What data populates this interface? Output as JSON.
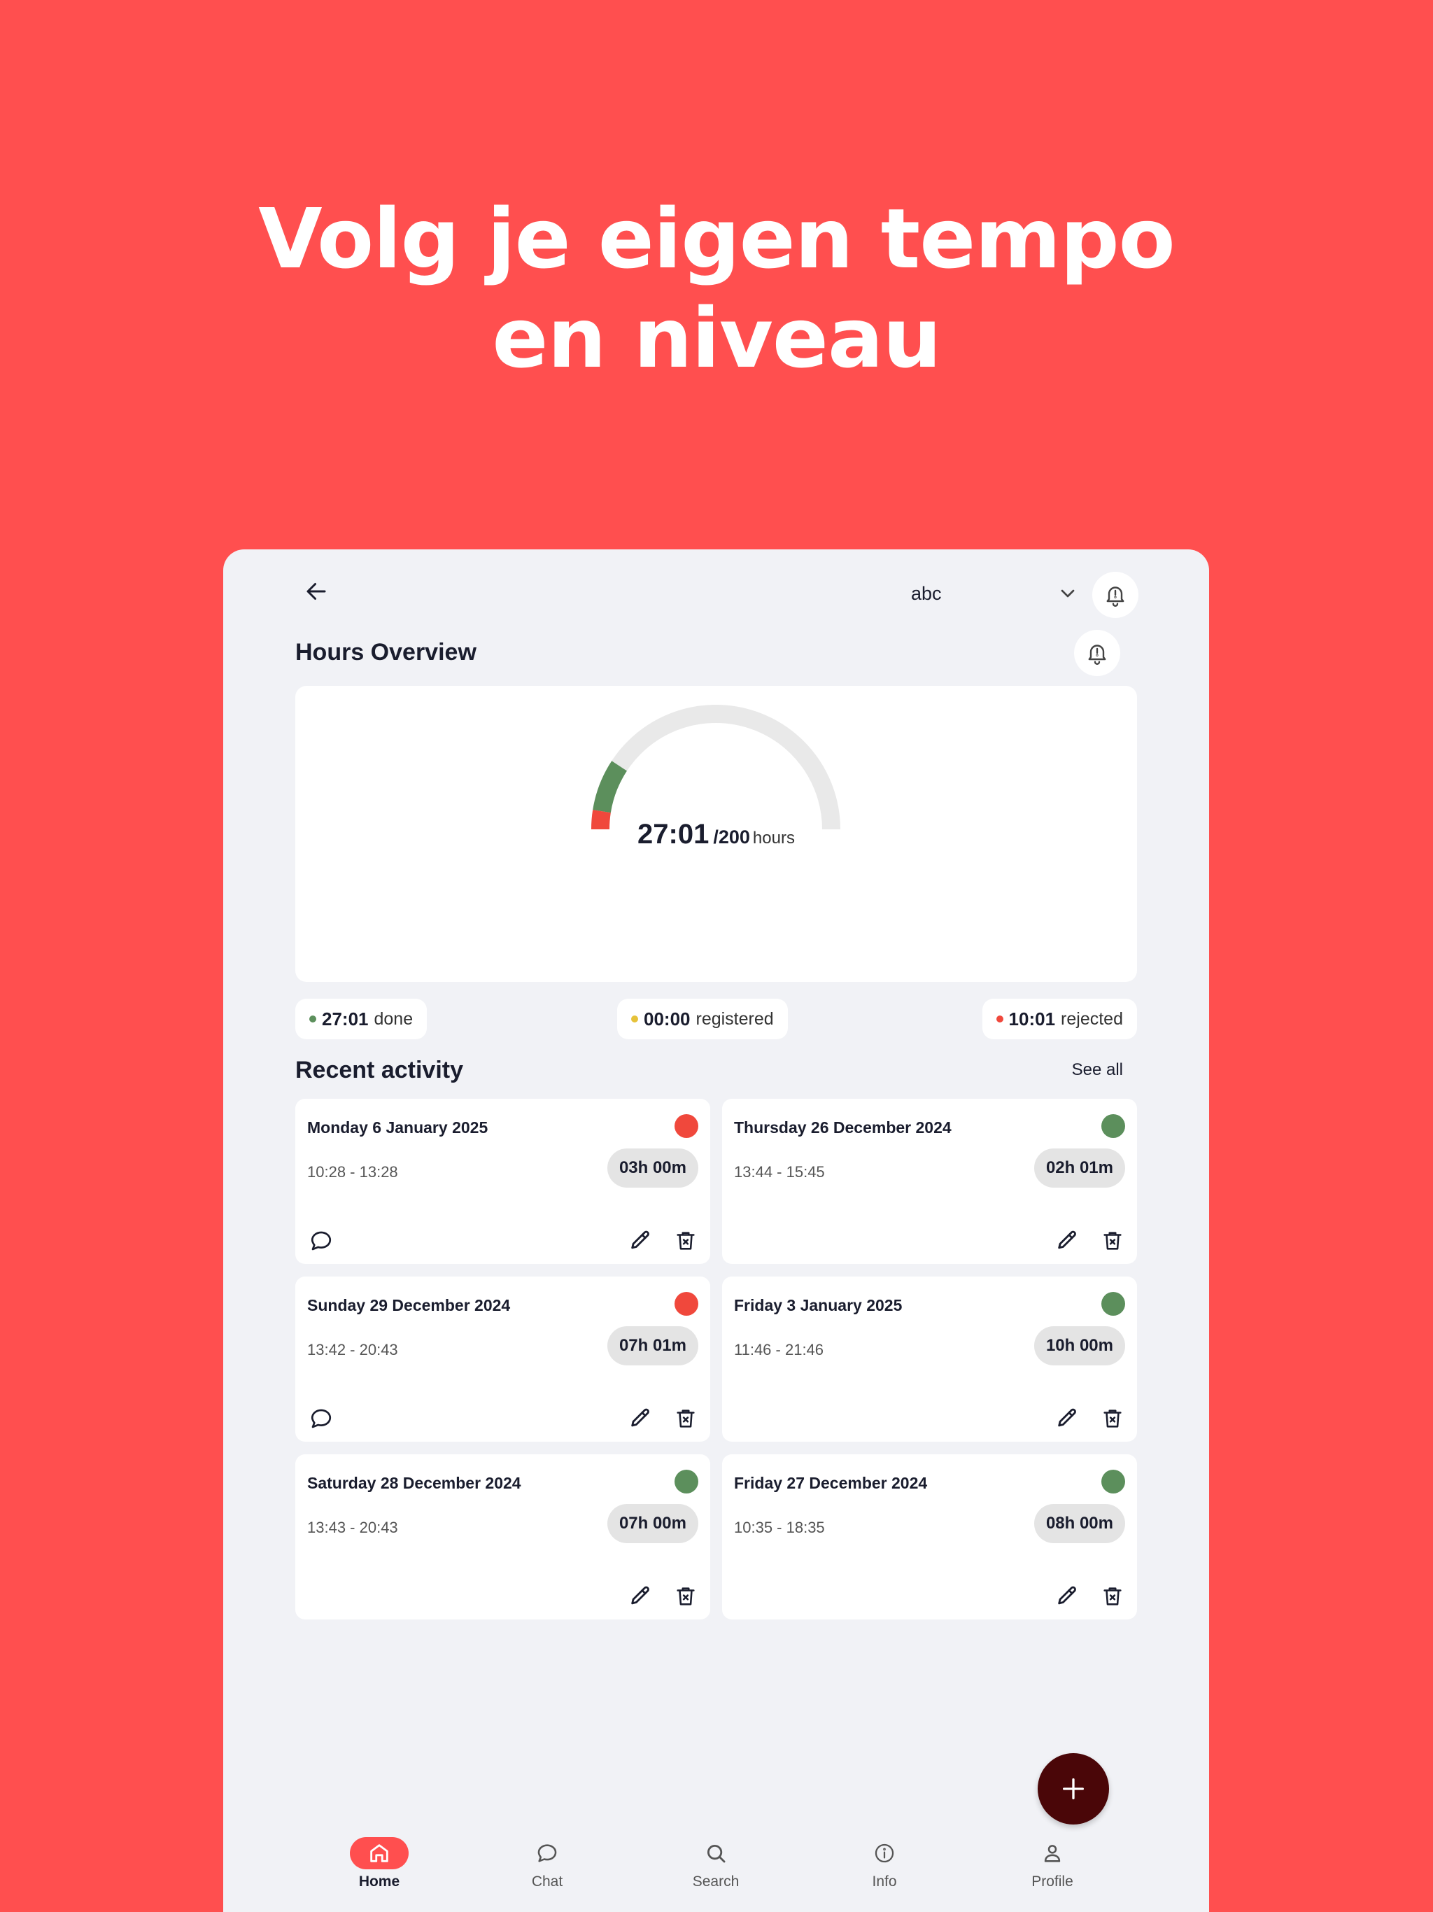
{
  "headline": {
    "line1": "Volg je eigen tempo",
    "line2": "en niveau"
  },
  "header": {
    "org_value": "abc",
    "icons": [
      "back-arrow-icon",
      "chevron-down-icon",
      "bell-icon"
    ]
  },
  "hours_overview": {
    "title": "Hours Overview",
    "gauge": {
      "done": "27:01",
      "total": "/200",
      "unit": "hours",
      "done_fraction": 0.135,
      "rejected_fraction": 0.05
    },
    "stats": [
      {
        "value": "27:01",
        "label": "done",
        "color": "#5C8F5C"
      },
      {
        "value": "00:00",
        "label": "registered",
        "color": "#E6C23A"
      },
      {
        "value": "10:01",
        "label": "rejected",
        "color": "#F0483C"
      }
    ]
  },
  "recent": {
    "title": "Recent activity",
    "see_all": "See all",
    "cards": [
      {
        "date": "Monday 6 January 2025",
        "time": "10:28 - 13:28",
        "duration": "03h 00m",
        "status_color": "#F0483C",
        "has_comment": true
      },
      {
        "date": "Thursday 26 December 2024",
        "time": "13:44 - 15:45",
        "duration": "02h 01m",
        "status_color": "#5C8F5C",
        "has_comment": false
      },
      {
        "date": "Sunday 29 December 2024",
        "time": "13:42 - 20:43",
        "duration": "07h 01m",
        "status_color": "#F0483C",
        "has_comment": true
      },
      {
        "date": "Friday 3 January 2025",
        "time": "11:46 - 21:46",
        "duration": "10h 00m",
        "status_color": "#5C8F5C",
        "has_comment": false
      },
      {
        "date": "Saturday 28 December 2024",
        "time": "13:43 - 20:43",
        "duration": "07h 00m",
        "status_color": "#5C8F5C",
        "has_comment": false
      },
      {
        "date": "Friday 27 December 2024",
        "time": "10:35 - 18:35",
        "duration": "08h 00m",
        "status_color": "#5C8F5C",
        "has_comment": false
      }
    ]
  },
  "nav": {
    "items": [
      {
        "label": "Home",
        "icon": "home-icon",
        "active": true
      },
      {
        "label": "Chat",
        "icon": "chat-icon",
        "active": false
      },
      {
        "label": "Search",
        "icon": "search-icon",
        "active": false
      },
      {
        "label": "Info",
        "icon": "info-icon",
        "active": false
      },
      {
        "label": "Profile",
        "icon": "profile-icon",
        "active": false
      }
    ]
  },
  "colors": {
    "brand": "#FF4F4F",
    "fab": "#4A0608",
    "done": "#5C8F5C",
    "rejected": "#F0483C",
    "track": "#E9E9E9"
  }
}
